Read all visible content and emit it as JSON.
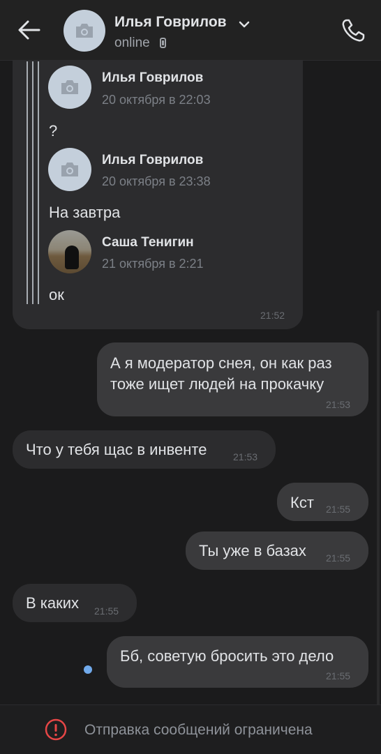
{
  "header": {
    "name": "Илья Говрилов",
    "status": "online"
  },
  "forwarded": {
    "time": "21:52",
    "items": [
      {
        "author": "Илья Говрилов",
        "date": "20 октября в 22:03",
        "text": "?"
      },
      {
        "author": "Илья Говрилов",
        "date": "20 октября в 23:38",
        "text": "На завтра"
      },
      {
        "author": "Саша Тенигин",
        "date": "21 октября в 2:21",
        "text": "ок"
      }
    ]
  },
  "messages": [
    {
      "direction": "out",
      "lines": [
        "А я модератор снея, он как раз",
        "тоже ищет людей на прокачку"
      ],
      "time": "21:53"
    },
    {
      "direction": "in",
      "text": "Что у тебя щас в инвенте",
      "time": "21:53"
    },
    {
      "direction": "out",
      "text": "Кст",
      "time": "21:55"
    },
    {
      "direction": "out",
      "text": "Ты уже в базах",
      "time": "21:55"
    },
    {
      "direction": "in",
      "text": "В каких",
      "time": "21:55"
    },
    {
      "direction": "out",
      "text": "Бб, советую бросить это дело",
      "time": "21:55",
      "unread": true
    }
  ],
  "footer": {
    "notice": "Отправка сообщений ограничена"
  },
  "colors": {
    "background": "#1b1b1c",
    "bubble_in": "#2c2c2e",
    "bubble_out": "#3a3a3c",
    "unread_dot": "#71aaeb",
    "warning": "#e64646"
  }
}
